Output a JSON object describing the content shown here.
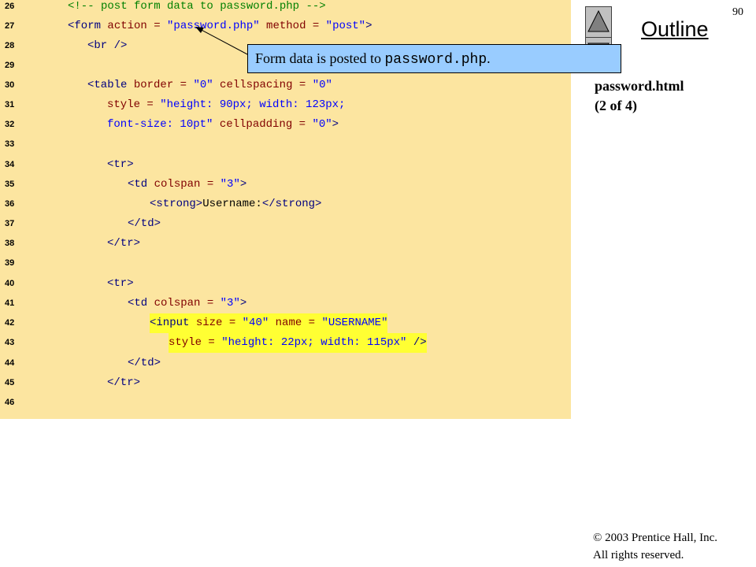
{
  "page_number": "90",
  "outline_title": "Outline",
  "file_label": {
    "line1": "password.html",
    "line2": "(2 of 4)"
  },
  "callout": {
    "prefix": "Form data is posted to ",
    "code": "password.php",
    "suffix": "."
  },
  "copyright": {
    "line1": "© 2003 Prentice Hall, Inc.",
    "line2": "All rights reserved."
  },
  "colors": {
    "code_background": "#fce5a0",
    "comment": "#008000",
    "tag": "#000080",
    "attribute": "#800000",
    "string": "#0000ff",
    "highlight": "#ffff33",
    "callout_background": "#99ccff"
  },
  "icons": {
    "previous": "triangle-up-icon",
    "next": "triangle-down-icon"
  },
  "code": {
    "line_numbers": [
      "26",
      "27",
      "28",
      "29",
      "30",
      "31",
      "32",
      "33",
      "34",
      "35",
      "36",
      "37",
      "38",
      "39",
      "40",
      "41",
      "42",
      "43",
      "44",
      "45",
      "46"
    ],
    "lines": {
      "l26": {
        "comment": "<!-- post form data to password.php -->"
      },
      "l27": {
        "open": "<form",
        "attr1": " action = ",
        "val1": "\"password.php\"",
        "attr2": " method = ",
        "val2": "\"post\"",
        "close": ">"
      },
      "l28": {
        "tag": "<br />"
      },
      "l30": {
        "open": "<table",
        "attr1": " border = ",
        "val1": "\"0\"",
        "attr2": " cellspacing = ",
        "val2": "\"0\""
      },
      "l31": {
        "attr1": "style = ",
        "val1": "\"height: 90px; width: 123px;"
      },
      "l32": {
        "val1": "font-size: 10pt\"",
        "attr2": " cellpadding = ",
        "val2": "\"0\"",
        "close": ">"
      },
      "l34": {
        "tag": "<tr>"
      },
      "l35": {
        "open": "<td",
        "attr1": " colspan = ",
        "val1": "\"3\"",
        "close": ">"
      },
      "l36": {
        "open": "<strong>",
        "text": "Username:",
        "close": "</strong>"
      },
      "l37": {
        "tag": "</td>"
      },
      "l38": {
        "tag": "</tr>"
      },
      "l40": {
        "tag": "<tr>"
      },
      "l41": {
        "open": "<td",
        "attr1": " colspan = ",
        "val1": "\"3\"",
        "close": ">"
      },
      "l42": {
        "open": "<input",
        "attr1": " size = ",
        "val1": "\"40\"",
        "attr2": " name = ",
        "val2": "\"USERNAME\""
      },
      "l43": {
        "attr1": "style = ",
        "val1": "\"height: 22px; width: 115px\"",
        "close": " />"
      },
      "l44": {
        "tag": "</td>"
      },
      "l45": {
        "tag": "</tr>"
      }
    }
  }
}
